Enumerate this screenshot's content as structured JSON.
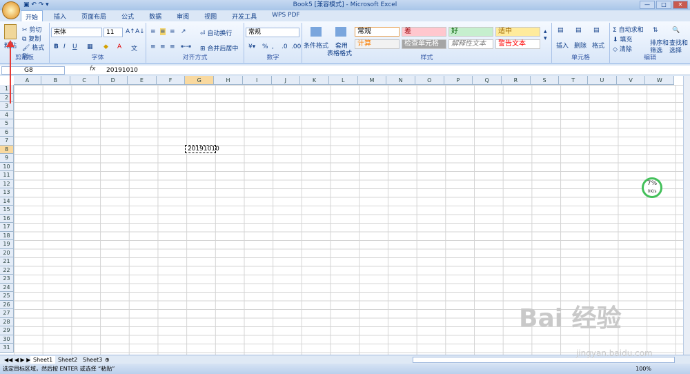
{
  "window": {
    "title": "Book5 [兼容模式] - Microsoft Excel"
  },
  "ribbon": {
    "tabs": [
      "开始",
      "插入",
      "页面布局",
      "公式",
      "数据",
      "审阅",
      "视图",
      "开发工具",
      "WPS PDF"
    ],
    "clipboard": {
      "paste": "粘贴",
      "cut": "剪切",
      "copy": "复制",
      "format_painter": "格式刷",
      "label": "剪贴板"
    },
    "font": {
      "name": "宋体",
      "size": "11",
      "label": "字体"
    },
    "alignment": {
      "wrap": "自动换行",
      "merge": "合并后居中",
      "label": "对齐方式"
    },
    "number": {
      "format": "常规",
      "label": "数字"
    },
    "styles": {
      "conditional": "条件格式",
      "table_format": "套用",
      "table_format2": "表格格式",
      "label": "样式",
      "tiles": [
        "常规",
        "差",
        "好",
        "适中",
        "计算",
        "检查单元格",
        "解释性文本",
        "警告文本"
      ]
    },
    "cells": {
      "insert": "插入",
      "delete": "删除",
      "format": "格式",
      "label": "单元格"
    },
    "editing": {
      "autosum": "自动求和",
      "fill": "填充",
      "clear": "清除",
      "sort": "排序和",
      "sort2": "筛选",
      "find": "查找和",
      "find2": "选择",
      "label": "编辑"
    }
  },
  "formula_bar": {
    "name_box": "G8",
    "value": "20191010"
  },
  "columns": [
    "A",
    "B",
    "C",
    "D",
    "E",
    "F",
    "G",
    "H",
    "I",
    "J",
    "K",
    "L",
    "M",
    "N",
    "O",
    "P",
    "Q",
    "R",
    "S",
    "T",
    "U",
    "V",
    "W"
  ],
  "rows": [
    "1",
    "2",
    "3",
    "4",
    "5",
    "6",
    "7",
    "8",
    "9",
    "10",
    "11",
    "12",
    "13",
    "14",
    "15",
    "16",
    "17",
    "18",
    "19",
    "20",
    "21",
    "22",
    "23",
    "24",
    "25",
    "26",
    "27",
    "28",
    "29",
    "30",
    "31"
  ],
  "selected_cell": {
    "column": "G",
    "row": "8",
    "value": "20191010"
  },
  "sheets": [
    "Sheet1",
    "Sheet2",
    "Sheet3"
  ],
  "status": {
    "message": "选定目标区域，然后按 ENTER 或选择 “粘贴”",
    "zoom": "100%"
  },
  "gauge": {
    "percent": "7%",
    "speed": "0K/s"
  },
  "watermark": {
    "text": "Bai 经验",
    "sub": "jingyan.baidu.com"
  }
}
